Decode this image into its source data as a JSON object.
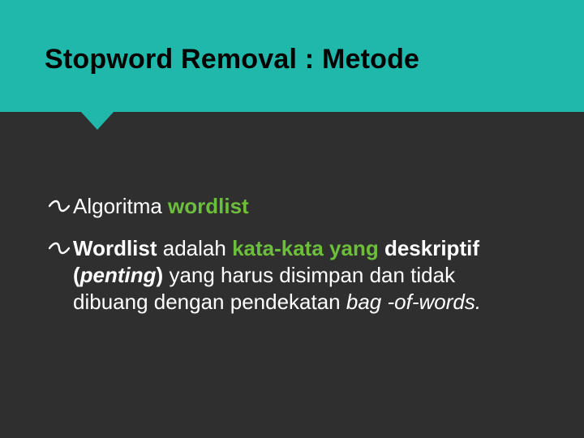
{
  "header": {
    "title": "Stopword Removal : Metode"
  },
  "bullets": {
    "first": {
      "lead": "Algoritma ",
      "highlight": "wordlist"
    },
    "second": {
      "w1": "Wordlist",
      "t1": "  adalah  ",
      "w2": "kata-kata  yang",
      "t2": " ",
      "w3": "deskriptif (",
      "w3i": "penting",
      "w3b": ")",
      "t3": "  yang harus disimpan dan tidak dibuang dengan  pendekatan  ",
      "w4": "bag -of-words.",
      "t4": ""
    }
  }
}
